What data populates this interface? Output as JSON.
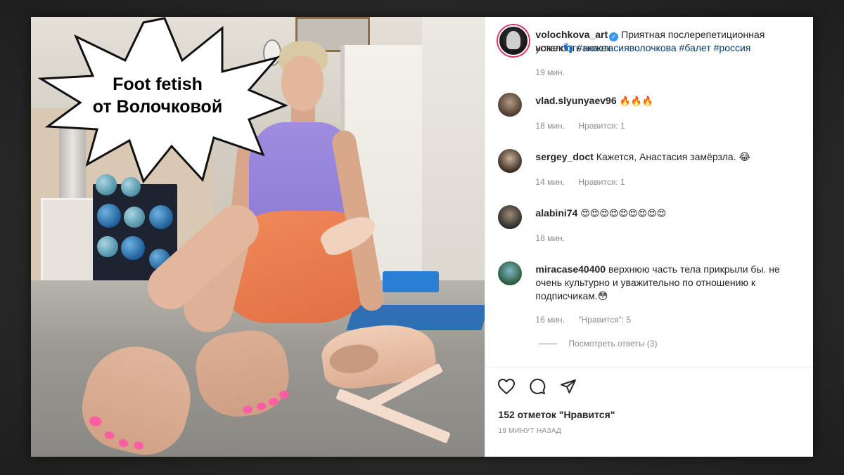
{
  "overlay": {
    "line1": "Foot fetish",
    "line2": "от Волочковой"
  },
  "post": {
    "author": "volochkova_art",
    "caption": "Приятная послерепетиционная усталость ножек",
    "caption_emoji": "👣",
    "hashtags": "#анастасияволочкова #балет #россия",
    "time": "19 мин."
  },
  "comments": [
    {
      "user": "vlad.slyunyaev96",
      "text": "🔥🔥🔥",
      "time": "18 мин.",
      "likes": "Нравится: 1"
    },
    {
      "user": "sergey_doct",
      "text": "Кажется, Анастасия замёрзла. 😂",
      "time": "14 мин.",
      "likes": "Нравится: 1"
    },
    {
      "user": "alabini74",
      "text": "😍😍😍😍😍😍😍😍😍",
      "time": "18 мин.",
      "likes": ""
    },
    {
      "user": "miracase40400",
      "text": "верхнюю часть тела прикрыли бы. не очень культурно и уважительно по отношению к подписчикам.😳",
      "time": "16 мин.",
      "likes": "\"Нравится\": 5"
    }
  ],
  "view_replies": "Посмотреть ответы (3)",
  "actions": {
    "like_icon": "heart-icon",
    "comment_icon": "comment-icon",
    "share_icon": "share-icon"
  },
  "likes_count": "152 отметок \"Нравится\"",
  "posted_ago": "19 МИНУТ НАЗАД",
  "colors": {
    "hashtag": "#00376b",
    "verified": "#3897f0",
    "muted": "#8e8e8e",
    "text": "#262626"
  }
}
